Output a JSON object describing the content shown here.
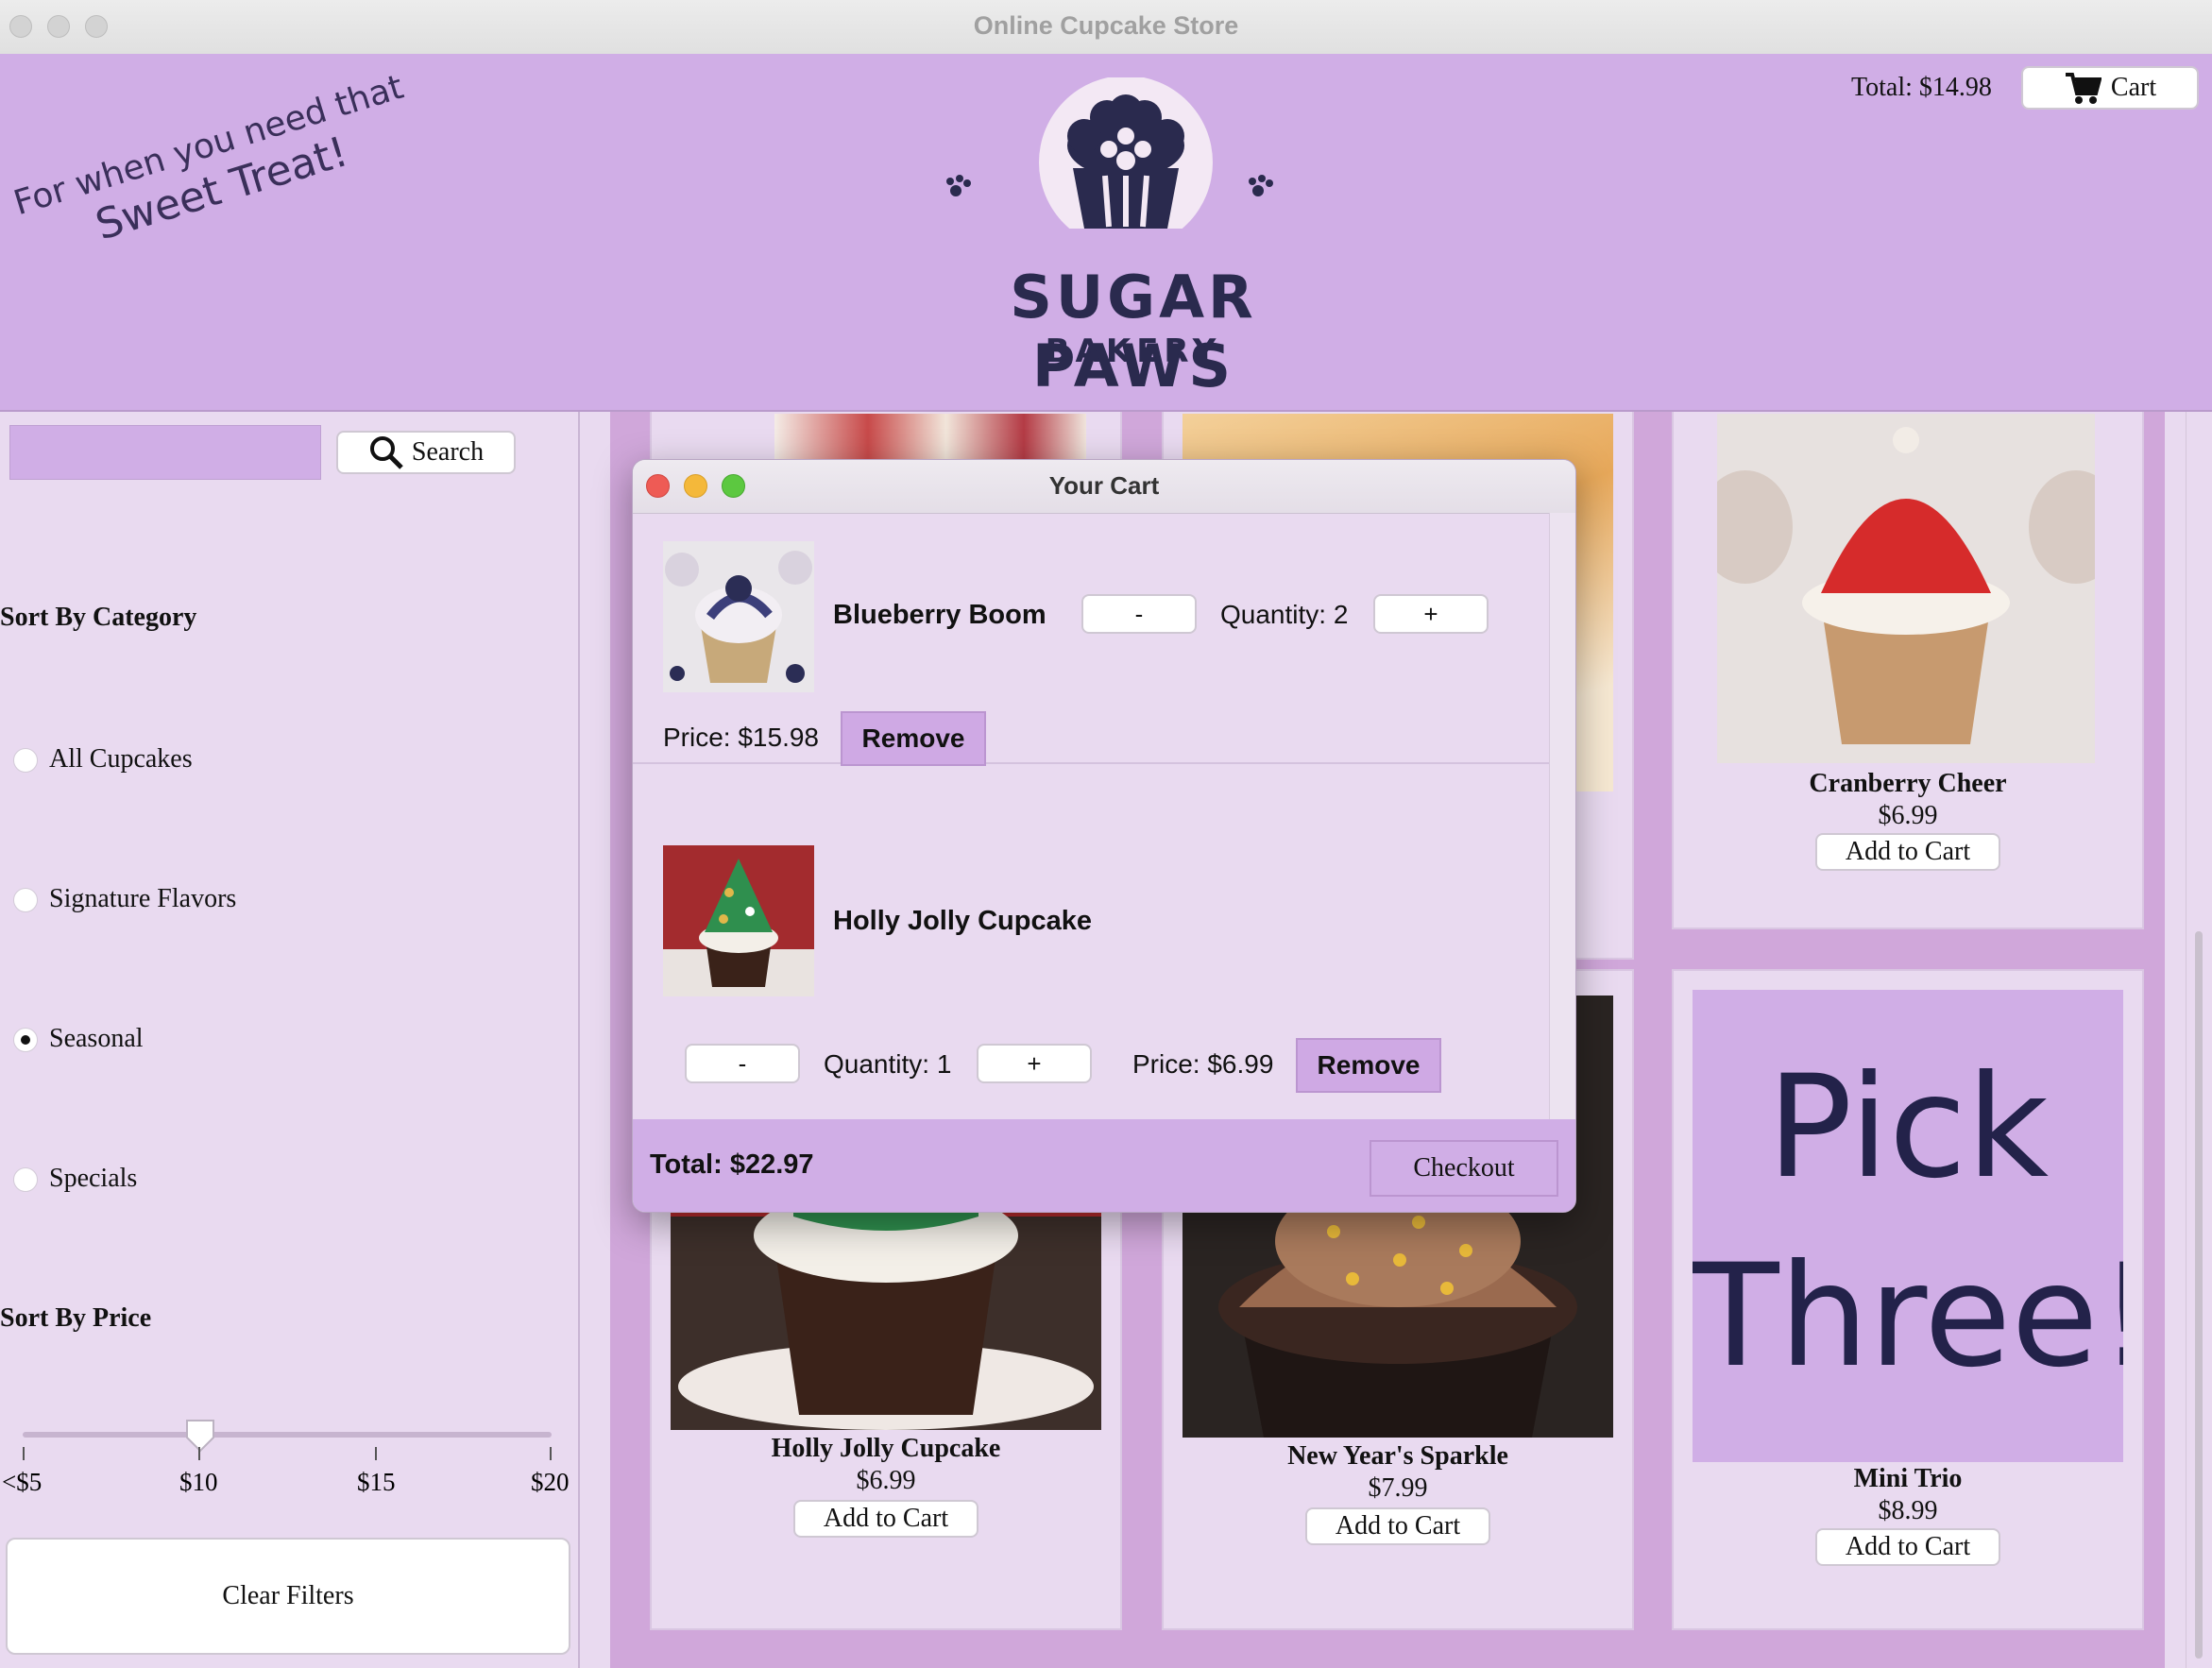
{
  "window": {
    "title": "Online Cupcake Store"
  },
  "header": {
    "tagline_line1": "For when you need that",
    "tagline_line2": "Sweet Treat!",
    "logo_title": "SUGAR PAWS",
    "logo_subtitle": "BAKERY",
    "total_text": "Total: $14.98",
    "cart_label": "Cart"
  },
  "sidebar": {
    "search_value": "",
    "search_label": "Search",
    "category_heading": "Sort By Category",
    "categories": [
      {
        "label": "All Cupcakes",
        "selected": false
      },
      {
        "label": "Signature Flavors",
        "selected": false
      },
      {
        "label": "Seasonal",
        "selected": true
      },
      {
        "label": "Specials",
        "selected": false
      }
    ],
    "price_heading": "Sort By Price",
    "price_ticks": [
      "<$5",
      "$10",
      "$15",
      "$20"
    ],
    "price_value": "$10",
    "clear_label": "Clear Filters"
  },
  "products": [
    {
      "name": "Cranberry Cheer",
      "price": "$6.99",
      "button": "Add to Cart"
    },
    {
      "name": "Holly Jolly Cupcake",
      "price": "$6.99",
      "button": "Add to Cart"
    },
    {
      "name": "New Year's Sparkle",
      "price": "$7.99",
      "button": "Add to Cart"
    },
    {
      "name": "Mini Trio",
      "price": "$8.99",
      "button": "Add to Cart",
      "promo_line1": "Pick",
      "promo_line2": "Three!"
    }
  ],
  "cart": {
    "title": "Your Cart",
    "items": [
      {
        "name": "Blueberry Boom",
        "quantity": "Quantity: 2",
        "price": "Price: $15.98",
        "minus": "-",
        "plus": "+",
        "remove": "Remove"
      },
      {
        "name": "Holly Jolly Cupcake",
        "quantity": "Quantity: 1",
        "price": "Price: $6.99",
        "minus": "-",
        "plus": "+",
        "remove": "Remove"
      }
    ],
    "total": "Total: $22.97",
    "checkout": "Checkout"
  },
  "colors": {
    "header": "#d0aee6",
    "sidebar": "#e9daf0",
    "accent": "#cfa9e4",
    "logo_navy": "#2a2a4e"
  }
}
